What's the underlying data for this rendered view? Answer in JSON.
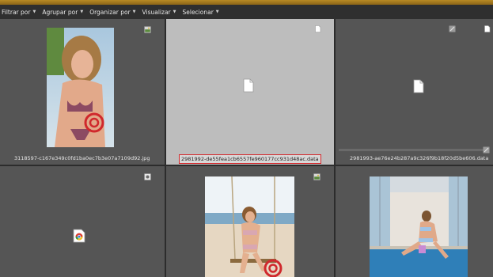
{
  "toolbar": {
    "filter_label": "Filtrar por",
    "group_label": "Agrupar por",
    "sort_label": "Organizar por",
    "view_label": "Visualizar",
    "select_label": "Selecionar"
  },
  "files": [
    {
      "name": "3118597-c167e349c0fd1ba0ec7b3e07a7109d92.jpg",
      "type": "jpg"
    },
    {
      "name": "2981992-de55fea1cb6557fe960177cc931d48ac.data",
      "type": "data"
    },
    {
      "name": "2981993-ae76e24b287a9c326f9b18f20d5be606.data",
      "type": "data"
    },
    {
      "name": "",
      "type": "html"
    },
    {
      "name": "",
      "type": "jpg"
    },
    {
      "name": "",
      "type": "jpg"
    }
  ],
  "colors": {
    "accent_stripe": "#b88a24",
    "selection_bg": "#bdbdbd",
    "rename_border": "#d4282c"
  }
}
